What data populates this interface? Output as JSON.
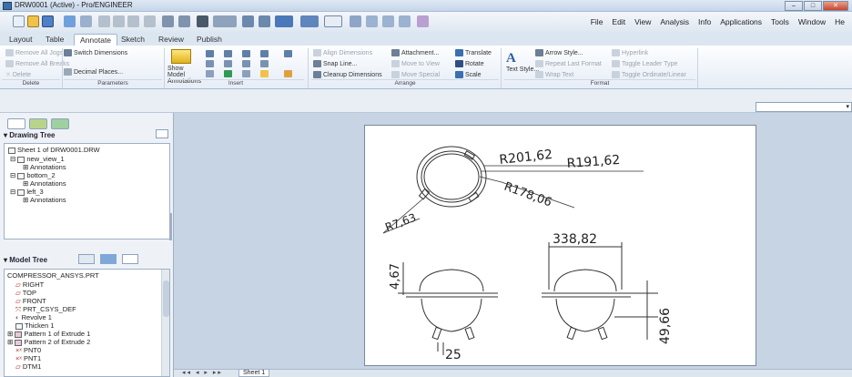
{
  "window": {
    "title": "DRW0001 (Active) - Pro/ENGINEER"
  },
  "menubar": [
    "File",
    "Edit",
    "View",
    "Analysis",
    "Info",
    "Applications",
    "Tools",
    "Window",
    "He"
  ],
  "tabs": [
    "Layout",
    "Table",
    "Annotate",
    "Sketch",
    "Review",
    "Publish"
  ],
  "active_tab": "Annotate",
  "ribbon": {
    "delete_group": {
      "items": [
        "Remove All Jogs",
        "Remove All Breaks",
        "Delete"
      ],
      "label": "Delete"
    },
    "parameters_group": {
      "items": [
        "Switch Dimensions",
        "Decimal Places..."
      ],
      "label": "Parameters"
    },
    "show_model_annotations": "Show Model Annotations",
    "insert_label": "Insert",
    "arrange_group": {
      "items": [
        "Align Dimensions",
        "Attachment...",
        "Translate",
        "Snap Line...",
        "Move to View",
        "Rotate",
        "Cleanup Dimensions",
        "Move Special",
        "Scale"
      ],
      "label": "Arrange"
    },
    "format_group": {
      "items": [
        "Arrow Style...",
        "Hyperlink",
        "Repeat Last Format",
        "Toggle Leader Type",
        "Wrap Text",
        "Toggle Ordinate/Linear"
      ],
      "text_style": "Text Style...",
      "label": "Format"
    }
  },
  "drawing_tree": {
    "header": "Drawing Tree",
    "nodes": [
      "Sheet 1 of DRW0001.DRW",
      "new_view_1",
      "Annotations",
      "bottom_2",
      "Annotations",
      "left_3",
      "Annotations"
    ]
  },
  "model_tree": {
    "header": "Model Tree",
    "nodes": [
      "COMPRESSOR_ANSYS.PRT",
      "RIGHT",
      "TOP",
      "FRONT",
      "PRT_CSYS_DEF",
      "Revolve 1",
      "Thicken 1",
      "Pattern 1 of Extrude 1",
      "Pattern 2 of Extrude 2",
      "PNT0",
      "PNT1",
      "DTM1"
    ]
  },
  "dimensions": {
    "r1": "R201,62",
    "r2": "R191,62",
    "r3": "R178,06",
    "r4": "R7,63",
    "d1": "338,82",
    "d2": "4,67",
    "d3": "49,66",
    "d4": "25"
  },
  "sheet_tab": "Sheet 1",
  "colors": {
    "accent": "#3a6fb0",
    "canvas": "#c6d4e4",
    "sheet": "#ffffff"
  }
}
